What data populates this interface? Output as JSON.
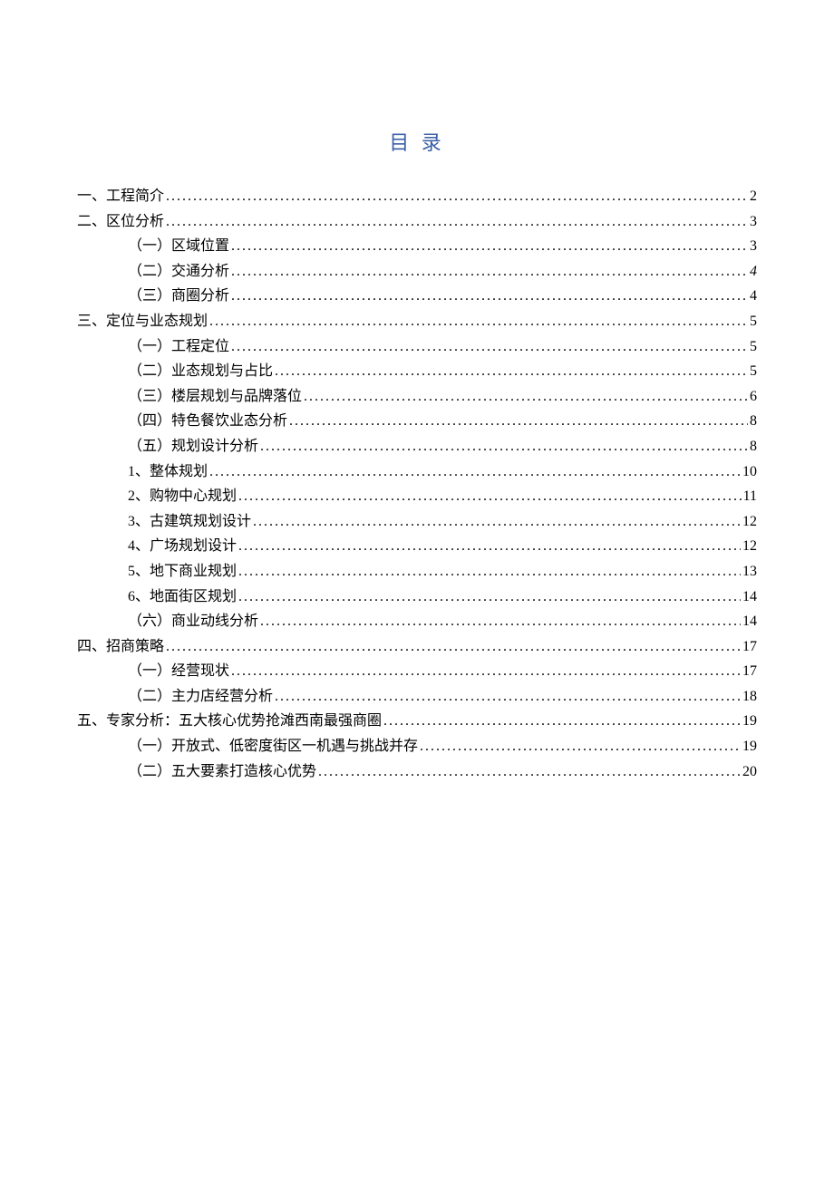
{
  "title": "目 录",
  "entries": [
    {
      "indent": 0,
      "label": "一、工程简介",
      "page": "2"
    },
    {
      "indent": 0,
      "label": "二、区位分析",
      "page": "3"
    },
    {
      "indent": 1,
      "label": "（一）区域位置",
      "page": "3"
    },
    {
      "indent": 1,
      "label": "（二）交通分析",
      "page": "4",
      "italicPage": true
    },
    {
      "indent": 1,
      "label": "（三）商圈分析",
      "page": "4"
    },
    {
      "indent": 0,
      "label": "三、定位与业态规划",
      "page": "5"
    },
    {
      "indent": 1,
      "label": "（一）工程定位",
      "page": "5"
    },
    {
      "indent": 1,
      "label": "（二）业态规划与占比",
      "page": "5"
    },
    {
      "indent": 1,
      "label": "（三）楼层规划与品牌落位",
      "page": "6"
    },
    {
      "indent": 1,
      "label": "（四）特色餐饮业态分析",
      "page": "8"
    },
    {
      "indent": 1,
      "label": "（五）规划设计分析",
      "page": "8"
    },
    {
      "indent": 2,
      "label": "1、整体规划",
      "page": "10"
    },
    {
      "indent": 2,
      "label": "2、购物中心规划",
      "page": "11"
    },
    {
      "indent": 2,
      "label": "3、古建筑规划设计",
      "page": "12"
    },
    {
      "indent": 2,
      "label": "4、广场规划设计",
      "page": "12"
    },
    {
      "indent": 2,
      "label": "5、地下商业规划",
      "page": "13"
    },
    {
      "indent": 2,
      "label": "6、地面街区规划",
      "page": "14"
    },
    {
      "indent": 1,
      "label": "（六）商业动线分析",
      "page": "14"
    },
    {
      "indent": 0,
      "label": "四、招商策略",
      "page": "17"
    },
    {
      "indent": 1,
      "label": "（一）经营现状",
      "page": "17"
    },
    {
      "indent": 1,
      "label": "（二）主力店经营分析",
      "page": "18"
    },
    {
      "indent": 0,
      "label": "五、专家分析：五大核心优势抢滩西南最强商圈",
      "page": "19"
    },
    {
      "indent": 1,
      "label": "（一）开放式、低密度街区一机遇与挑战并存",
      "page": "19"
    },
    {
      "indent": 1,
      "label": "（二）五大要素打造核心优势",
      "page": "20"
    }
  ]
}
